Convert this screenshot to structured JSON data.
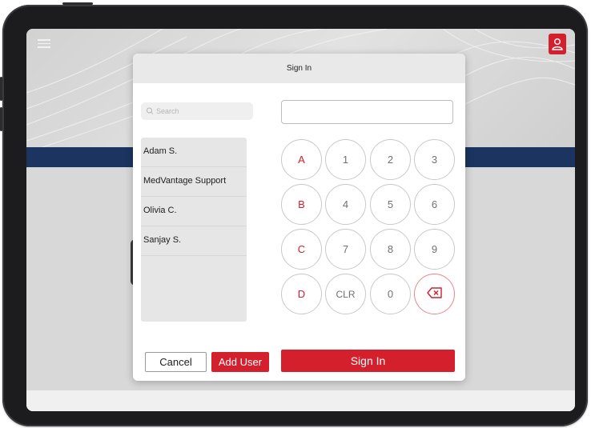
{
  "modal": {
    "title": "Sign In",
    "search": {
      "placeholder": "Search",
      "icon": "search-icon"
    },
    "users": [
      {
        "name": "Adam S."
      },
      {
        "name": "MedVantage Support"
      },
      {
        "name": "Olivia C."
      },
      {
        "name": "Sanjay S."
      }
    ],
    "keypad": {
      "rows": [
        [
          "A",
          "1",
          "2",
          "3"
        ],
        [
          "B",
          "4",
          "5",
          "6"
        ],
        [
          "C",
          "7",
          "8",
          "9"
        ],
        [
          "D",
          "CLR",
          "0",
          "backspace-icon"
        ]
      ]
    },
    "buttons": {
      "cancel": "Cancel",
      "add_user": "Add User",
      "sign_in": "Sign In"
    }
  },
  "header_icons": {
    "menu": "hamburger-menu-icon",
    "user": "user-icon"
  },
  "colors": {
    "brand_red": "#d4202c",
    "nav_blue": "#1b3560",
    "key_border": "#c9c9c9",
    "key_letter": "#d0202b"
  }
}
